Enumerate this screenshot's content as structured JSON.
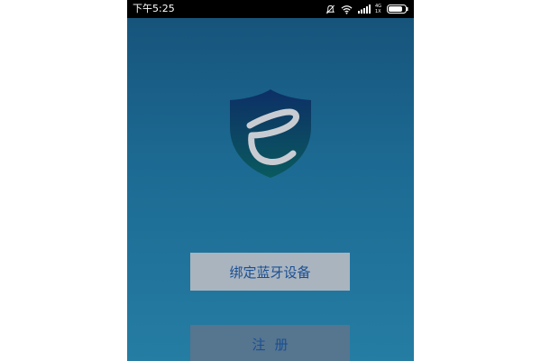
{
  "status_bar": {
    "time": "下午5:25",
    "network_top": "4G",
    "network_bottom": "1X",
    "icons": [
      "mute-icon",
      "wifi-icon",
      "signal-icon",
      "battery-icon"
    ]
  },
  "logo": {
    "icon": "shield-e-logo",
    "colors": {
      "shield_top": "#0d2f66",
      "shield_bottom": "#0a5a5f",
      "letter": "#c8ccd2"
    }
  },
  "actions": {
    "bind_bluetooth_label": "绑定蓝牙设备",
    "register_label": "注册"
  },
  "colors": {
    "background_top": "#165178",
    "background_bottom": "#257da3",
    "button_text": "#1a4f93"
  }
}
